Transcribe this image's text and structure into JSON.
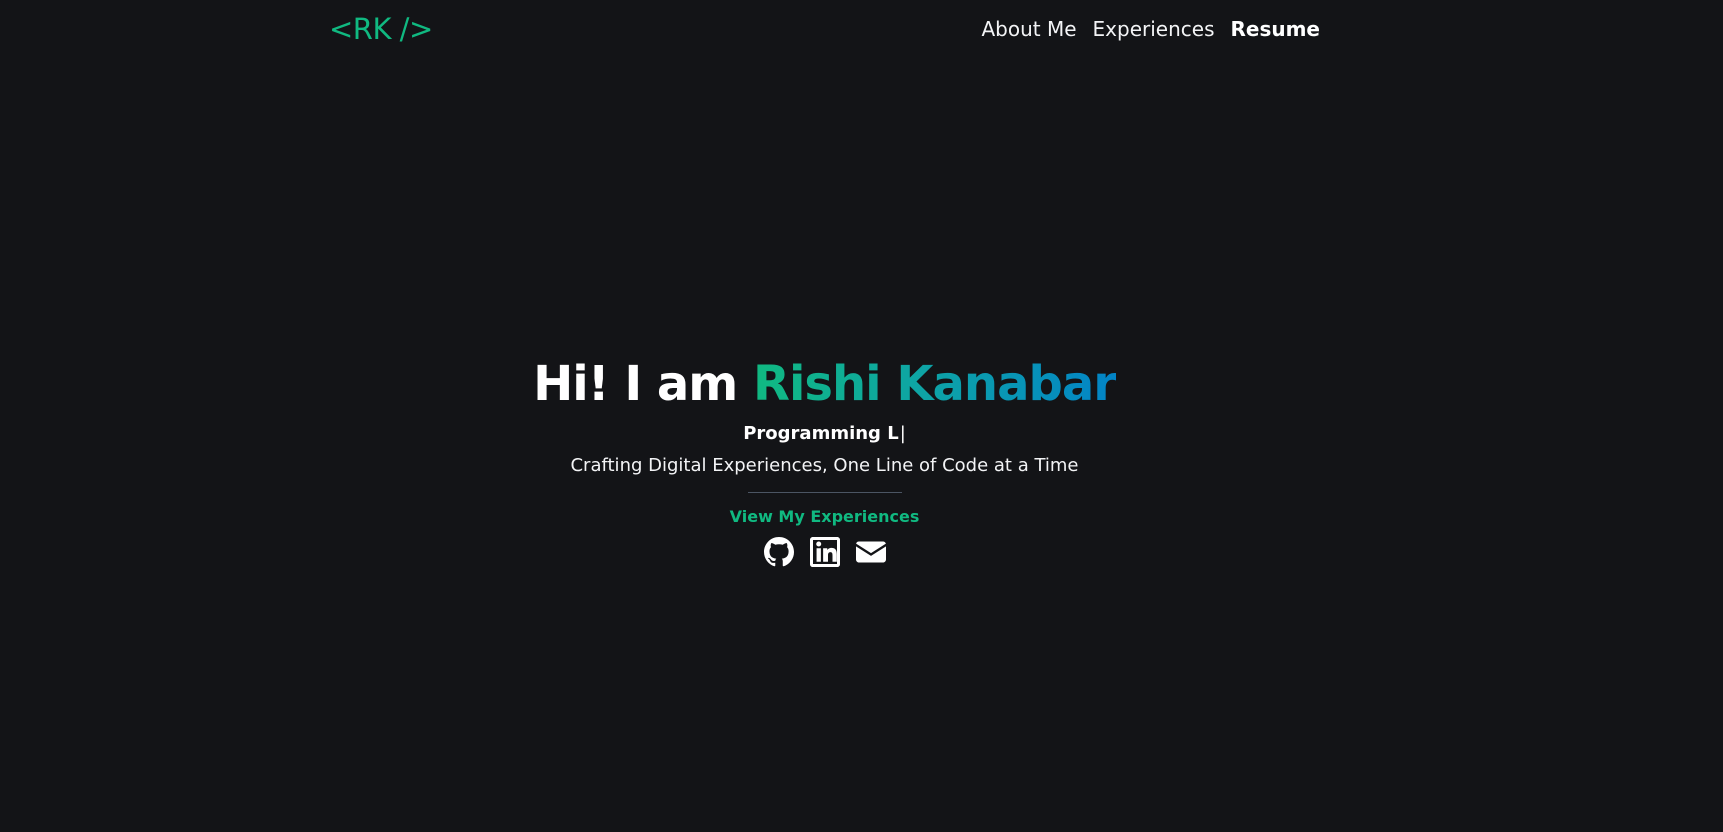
{
  "navbar": {
    "logo": "<RK />",
    "links": [
      {
        "label": "About Me"
      },
      {
        "label": "Experiences"
      },
      {
        "label": "Resume"
      }
    ]
  },
  "hero": {
    "greeting": "Hi! I am ",
    "name": "Rishi Kanabar",
    "typing_text": "Programming L",
    "typing_cursor": "|",
    "tagline": "Crafting Digital Experiences, One Line of Code at a Time",
    "cta_label": "View My Experiences",
    "socials": [
      {
        "icon": "github-icon"
      },
      {
        "icon": "linkedin-icon"
      },
      {
        "icon": "envelope-icon"
      }
    ]
  },
  "colors": {
    "background": "#131417",
    "accent": "#10b981",
    "gradient_end": "#0284c7",
    "text": "#ffffff"
  }
}
